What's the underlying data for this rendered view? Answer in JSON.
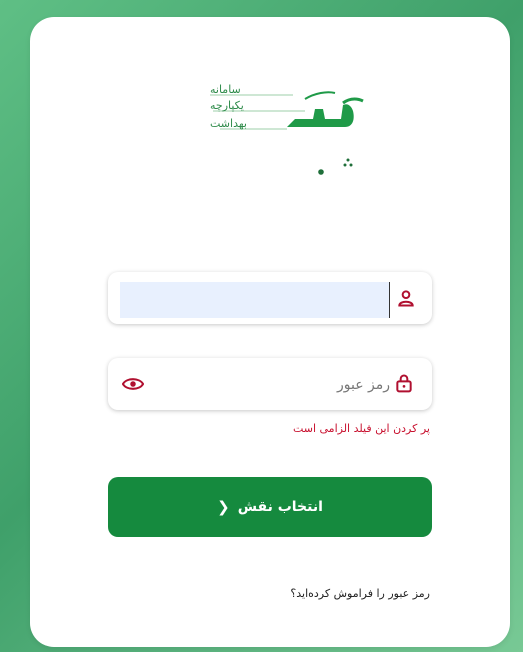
{
  "logo": {
    "line1": "سامانه",
    "line2": "یکپارچه",
    "line3": "بهداشت",
    "brand": "سیب"
  },
  "login": {
    "username": {
      "value": "",
      "placeholder": "",
      "icon": "user-icon"
    },
    "password": {
      "value": "",
      "placeholder": "رمز عبور",
      "icon": "lock-icon",
      "toggle_icon": "eye-icon"
    },
    "error_text": "پر کردن این فیلد الزامی است",
    "submit_label": "انتخاب نقش",
    "forgot_label": "رمز عبور را فراموش کرده‌اید؟"
  },
  "colors": {
    "primary": "#158a3e",
    "error": "#c8102e",
    "background": "#5fbf85"
  }
}
